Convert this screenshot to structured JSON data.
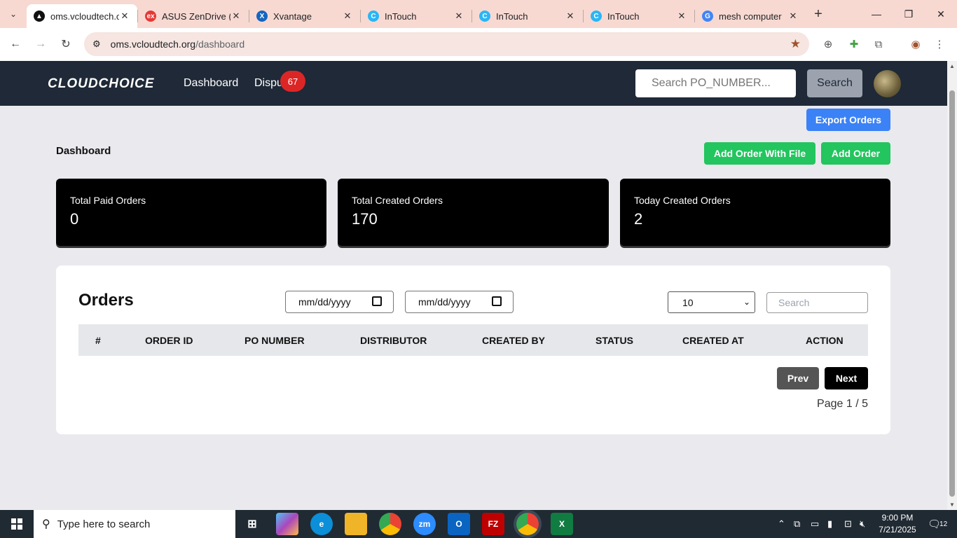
{
  "browser": {
    "tabs": [
      {
        "title": "oms.vcloudtech.o",
        "fav_color": "#111111",
        "fav": "▲",
        "active": true
      },
      {
        "title": "ASUS ZenDrive (",
        "fav_color": "#e53935",
        "fav": "ex",
        "active": false
      },
      {
        "title": "Xvantage",
        "fav_color": "#1565c0",
        "fav": "X",
        "active": false
      },
      {
        "title": "InTouch",
        "fav_color": "#29b6f6",
        "fav": "C",
        "active": false
      },
      {
        "title": "InTouch",
        "fav_color": "#29b6f6",
        "fav": "C",
        "active": false
      },
      {
        "title": "InTouch",
        "fav_color": "#29b6f6",
        "fav": "C",
        "active": false
      },
      {
        "title": "mesh computer",
        "fav_color": "#4285f4",
        "fav": "G",
        "active": false
      }
    ],
    "url_host": "oms.vcloudtech.org",
    "url_path": "/dashboard"
  },
  "app": {
    "logo": "CLOUDCHOICE",
    "nav": {
      "dashboard": "Dashboard",
      "disputes": "Dispu",
      "disputes_badge": "67"
    },
    "search_placeholder": "Search PO_NUMBER...",
    "search_button": "Search"
  },
  "actions": {
    "export": "Export Orders",
    "add_with_file": "Add Order With File",
    "add_order": "Add Order"
  },
  "page_title": "Dashboard",
  "stats": [
    {
      "label": "Total Paid Orders",
      "value": "0"
    },
    {
      "label": "Total Created Orders",
      "value": "170"
    },
    {
      "label": "Today Created Orders",
      "value": "2"
    }
  ],
  "orders": {
    "heading": "Orders",
    "date_from": "mm/dd/yyyy",
    "date_to": "mm/dd/yyyy",
    "page_size": "10",
    "search_placeholder": "Search",
    "columns": [
      "#",
      "ORDER ID",
      "PO NUMBER",
      "DISTRIBUTOR",
      "CREATED BY",
      "STATUS",
      "CREATED AT",
      "ACTION"
    ],
    "prev": "Prev",
    "next": "Next",
    "page_info": "Page 1 / 5"
  },
  "taskbar": {
    "search_placeholder": "Type here to search",
    "time": "9:00 PM",
    "date": "7/21/2025",
    "notifications": "12"
  }
}
